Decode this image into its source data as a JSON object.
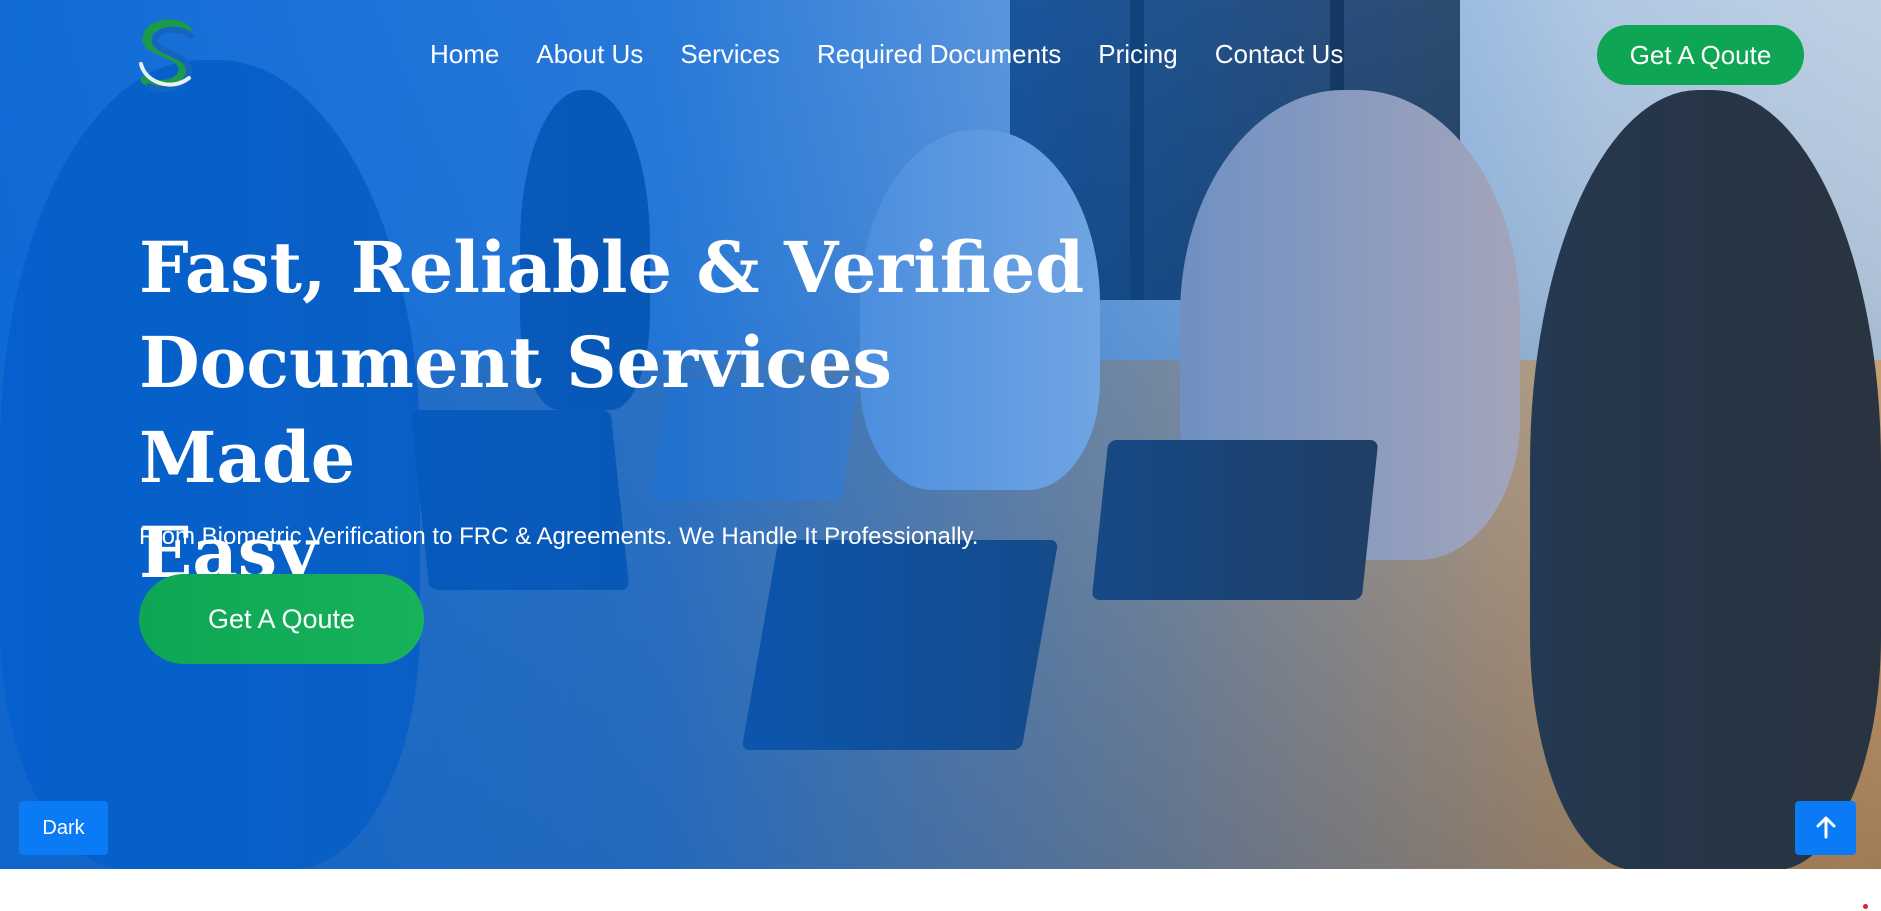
{
  "brand": {
    "logo_icon": "s-swoosh-logo-icon",
    "colors": {
      "primary_blue": "#0062d6",
      "accent_green": "#0ea654",
      "button_blue": "#0a7bf5"
    }
  },
  "nav": {
    "items": [
      {
        "label": "Home"
      },
      {
        "label": "About Us"
      },
      {
        "label": "Services"
      },
      {
        "label": "Required Documents"
      },
      {
        "label": "Pricing"
      },
      {
        "label": "Contact Us"
      }
    ],
    "cta_label": "Get A Qoute"
  },
  "hero": {
    "title_lines": [
      "Fast, Reliable & Verified",
      "Document Services Made",
      "Easy"
    ],
    "subtitle": "From Biometric Verification to FRC & Agreements. We Handle It Professionally.",
    "cta_label": "Get A Qoute"
  },
  "controls": {
    "theme_toggle_label": "Dark",
    "back_to_top_icon": "arrow-up-icon"
  }
}
